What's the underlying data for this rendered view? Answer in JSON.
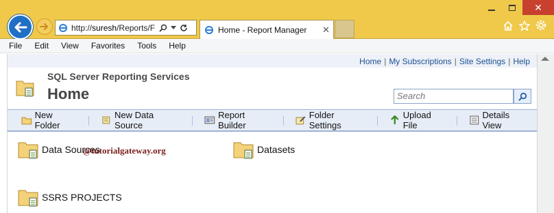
{
  "browser": {
    "address_prefix": "http://",
    "address_host": "suresh",
    "address_rest": "/Reports/F",
    "tab_title": "Home - Report Manager"
  },
  "menu": [
    "File",
    "Edit",
    "View",
    "Favorites",
    "Tools",
    "Help"
  ],
  "top_links": {
    "home": "Home",
    "subscriptions": "My Subscriptions",
    "site_settings": "Site Settings",
    "help": "Help",
    "separator": "|"
  },
  "site": {
    "name": "SQL Server Reporting Services",
    "title": "Home"
  },
  "search": {
    "placeholder": "Search"
  },
  "toolbar": {
    "new_folder": "New Folder",
    "new_data_source": "New Data Source",
    "report_builder": "Report Builder",
    "folder_settings": "Folder Settings",
    "upload_file": "Upload File",
    "details_view": "Details View"
  },
  "items": [
    {
      "label": "Data Sources"
    },
    {
      "label": "Datasets"
    },
    {
      "label": "SSRS PROJECTS"
    }
  ],
  "watermark": "@tutorialgateway.org",
  "colors": {
    "chrome": "#f0c94a",
    "close_button": "#c7412e",
    "link": "#1c4f92",
    "toolbar_bg": "#e7edf7",
    "folder": "#f3d27a"
  }
}
